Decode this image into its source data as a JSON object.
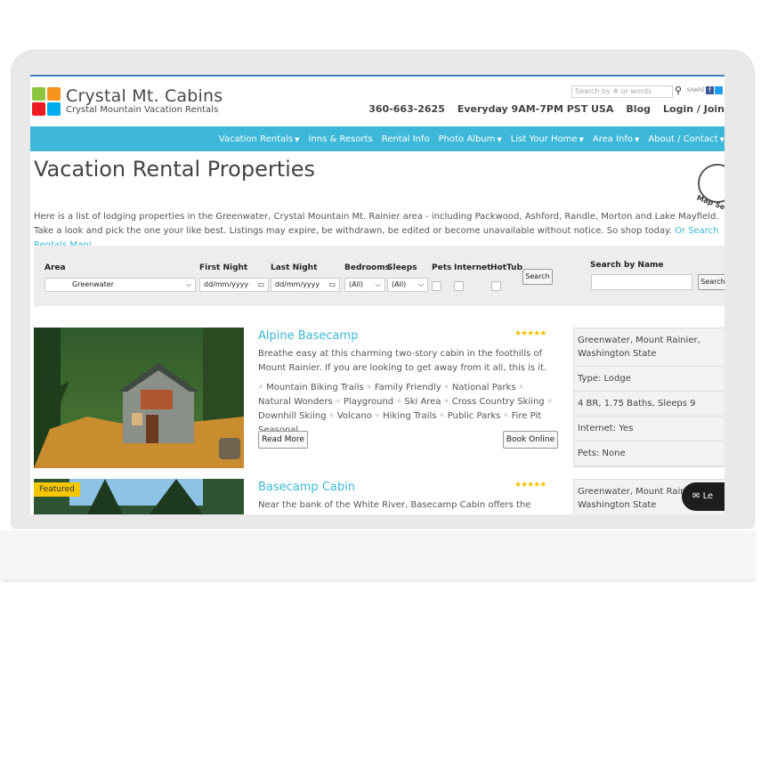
{
  "logo": {
    "title": "Crystal Mt. Cabins",
    "subtitle": "Crystal Mountain Vacation Rentals",
    "colors": [
      "#8cc63f",
      "#f7941d",
      "#ed1c24",
      "#00aeef"
    ]
  },
  "top_search": {
    "placeholder": "Search by # or words",
    "share_label": "SHARE"
  },
  "contact": {
    "phone": "360-663-2625",
    "hours": "Everyday 9AM-7PM PST USA",
    "blog": "Blog",
    "login": "Login / Join"
  },
  "nav": {
    "items": [
      {
        "label": "Vacation Rentals",
        "dropdown": true
      },
      {
        "label": "Inns & Resorts",
        "dropdown": false
      },
      {
        "label": "Rental Info",
        "dropdown": false
      },
      {
        "label": "Photo Album",
        "dropdown": true
      },
      {
        "label": "List Your Home",
        "dropdown": true
      },
      {
        "label": "Area Info",
        "dropdown": true
      },
      {
        "label": "About / Contact",
        "dropdown": true
      }
    ]
  },
  "page": {
    "title": "Vacation Rental Properties",
    "map_search_label": "Map Sea",
    "intro": "Here is a list of lodging properties in the Greenwater, Crystal Mountain Mt. Rainier area - including Packwood, Ashford, Randle, Morton and Lake Mayfield. Take a look and pick the one your like best. Listings may expire, be withdrawn, be edited or become unavailable without notice. So shop today.",
    "intro_link": "Or Search Rentals Map!"
  },
  "filter": {
    "area_label": "Area",
    "area_value": "Greenwater",
    "first_night_label": "First Night",
    "first_night_placeholder": "dd/mm/yyyy",
    "last_night_label": "Last Night",
    "last_night_placeholder": "dd/mm/yyyy",
    "bedrooms_label": "Bedrooms",
    "bedrooms_value": "(All)",
    "sleeps_label": "Sleeps",
    "sleeps_value": "(All)",
    "pets_label": "Pets",
    "internet_label": "Internet",
    "hottub_label": "HotTub",
    "search_button": "Search",
    "by_name_label": "Search by Name",
    "by_name_button": "Search"
  },
  "listings": [
    {
      "title": "Alpine Basecamp",
      "stars": "★★★★★",
      "rating": 4.5,
      "description": "Breathe easy at this charming two-story cabin in the foothills of Mount Rainier. If you are looking to get away from it all, this is it.",
      "amenities": "◦ Mountain Biking Trails ◦ Family Friendly ◦ National Parks ◦ Natural Wonders ◦ Playground ◦ Ski Area ◦ Cross Country Skiing ◦ Downhill Skiing ◦ Volcano ◦ Hiking Trails ◦ Public Parks ◦ Fire Pit Seasonal",
      "read_more": "Read More",
      "book_online": "Book Online",
      "info": [
        "Greenwater, Mount Rainier, Washington State",
        "Type: Lodge",
        "4 BR, 1.75 Baths, Sleeps 9",
        "Internet: Yes",
        "Pets: None"
      ]
    },
    {
      "title": "Basecamp Cabin",
      "stars": "★★★★★",
      "rating": 4,
      "featured": "Featured",
      "description": "Near the bank of the White River, Basecamp Cabin offers the perfect",
      "info": [
        "Greenwater, Mount Rainier, Washington State"
      ]
    }
  ],
  "leave_message": "Le"
}
